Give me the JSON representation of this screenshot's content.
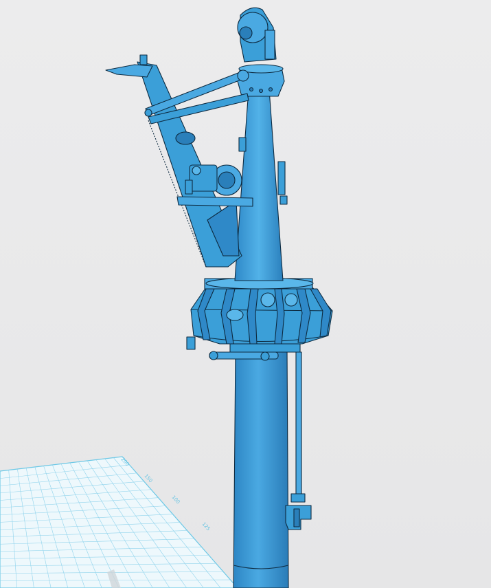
{
  "viewport": {
    "name": "3d-model-viewport",
    "background_color": "#e9e9ea"
  },
  "grid": {
    "color": "#6cc8e6",
    "tick_labels": [
      "200",
      "150",
      "100",
      "125"
    ]
  },
  "model": {
    "description_icon": "crane-mast-model",
    "fill_color": "#3b9fd8",
    "shade_color": "#2a7fba",
    "highlight_color": "#6cc0ee",
    "outline_color": "#0d2a40"
  }
}
